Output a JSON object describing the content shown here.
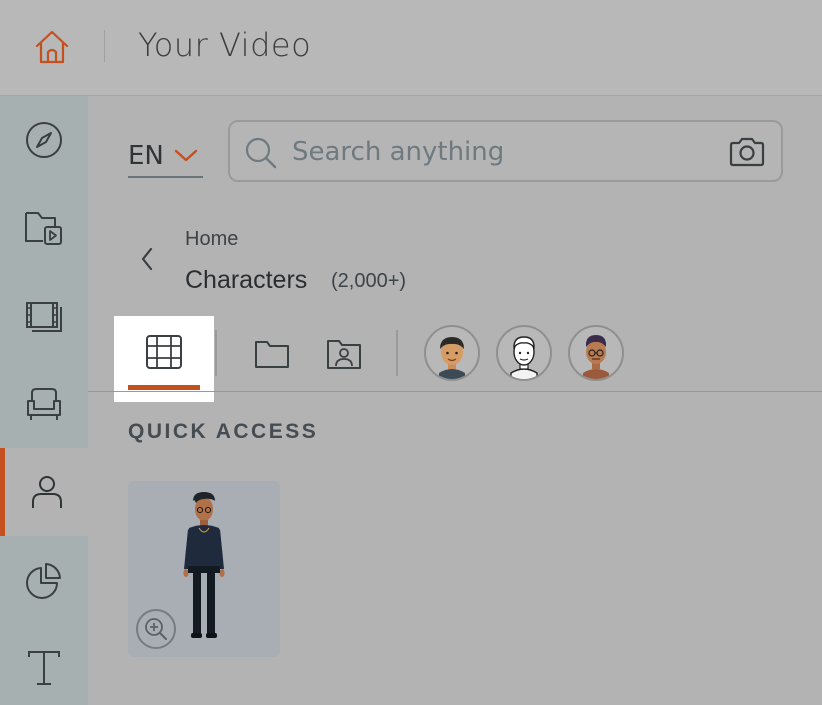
{
  "header": {
    "title": "Your Video",
    "home_icon": "home-icon"
  },
  "sidebar": {
    "items": [
      {
        "name": "explore",
        "icon": "compass-icon"
      },
      {
        "name": "media",
        "icon": "folder-video-icon"
      },
      {
        "name": "scenes",
        "icon": "film-icon"
      },
      {
        "name": "props",
        "icon": "armchair-icon"
      },
      {
        "name": "characters",
        "icon": "person-icon",
        "active": true
      },
      {
        "name": "charts",
        "icon": "pie-chart-icon"
      },
      {
        "name": "text",
        "icon": "text-icon"
      }
    ],
    "active_color": "#c4501d"
  },
  "search": {
    "language": "EN",
    "placeholder": "Search anything"
  },
  "breadcrumb": {
    "parent": "Home",
    "title": "Characters",
    "count": "(2,000+)"
  },
  "tabs": [
    {
      "name": "all",
      "icon": "grid-icon",
      "selected": true
    },
    {
      "name": "folder",
      "icon": "folder-icon"
    },
    {
      "name": "my-characters",
      "icon": "user-folder-icon"
    },
    {
      "name": "style-1",
      "icon": "character-avatar-icon"
    },
    {
      "name": "style-2",
      "icon": "character-avatar-icon"
    },
    {
      "name": "style-3",
      "icon": "character-avatar-icon"
    }
  ],
  "quick_access": {
    "title": "QUICK ACCESS"
  }
}
